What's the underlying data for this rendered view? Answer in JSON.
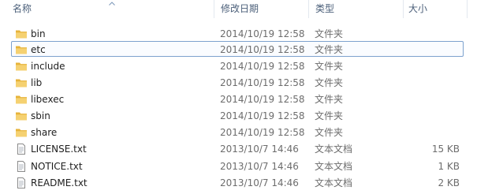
{
  "columns": {
    "name": "名称",
    "date": "修改日期",
    "type": "类型",
    "size": "大小"
  },
  "colors": {
    "header_text": "#4c607a",
    "hover_border": "#7da2ce",
    "folder": "#f0c14a"
  },
  "rows": [
    {
      "name": "bin",
      "date": "2014/10/19 12:58",
      "type": "文件夹",
      "size": "",
      "icon": "folder-icon"
    },
    {
      "name": "etc",
      "date": "2014/10/19 12:58",
      "type": "文件夹",
      "size": "",
      "icon": "folder-icon"
    },
    {
      "name": "include",
      "date": "2014/10/19 12:58",
      "type": "文件夹",
      "size": "",
      "icon": "folder-icon"
    },
    {
      "name": "lib",
      "date": "2014/10/19 12:58",
      "type": "文件夹",
      "size": "",
      "icon": "folder-icon"
    },
    {
      "name": "libexec",
      "date": "2014/10/19 12:58",
      "type": "文件夹",
      "size": "",
      "icon": "folder-icon"
    },
    {
      "name": "sbin",
      "date": "2014/10/19 12:58",
      "type": "文件夹",
      "size": "",
      "icon": "folder-icon"
    },
    {
      "name": "share",
      "date": "2014/10/19 12:58",
      "type": "文件夹",
      "size": "",
      "icon": "folder-icon"
    },
    {
      "name": "LICENSE.txt",
      "date": "2013/10/7 14:46",
      "type": "文本文档",
      "size": "15 KB",
      "icon": "text-file-icon"
    },
    {
      "name": "NOTICE.txt",
      "date": "2013/10/7 14:46",
      "type": "文本文档",
      "size": "1 KB",
      "icon": "text-file-icon"
    },
    {
      "name": "README.txt",
      "date": "2013/10/7 14:46",
      "type": "文本文档",
      "size": "2 KB",
      "icon": "text-file-icon"
    }
  ]
}
